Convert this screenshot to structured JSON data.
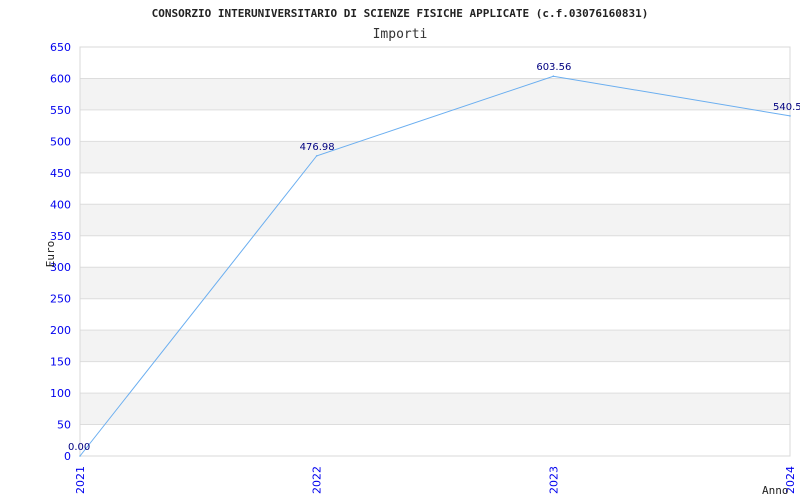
{
  "chart_data": {
    "type": "line",
    "title": "CONSORZIO INTERUNIVERSITARIO DI SCIENZE FISICHE APPLICATE (c.f.03076160831)",
    "subtitle": "Importi",
    "xlabel": "Anno",
    "ylabel": "Euro",
    "categories": [
      "2021",
      "2022",
      "2023",
      "2024"
    ],
    "values": [
      0.0,
      476.98,
      603.56,
      540.5
    ],
    "data_labels": [
      "0.00",
      "476.98",
      "603.56",
      "540.5"
    ],
    "ylim": [
      0,
      650
    ],
    "yticks": [
      0,
      50,
      100,
      150,
      200,
      250,
      300,
      350,
      400,
      450,
      500,
      550,
      600,
      650
    ],
    "grid": true,
    "colors": {
      "line": "#6aaef0",
      "tick_labels": "#0000ee",
      "data_labels": "#000080",
      "band": "#f3f3f3",
      "grid": "#dddddd"
    }
  }
}
